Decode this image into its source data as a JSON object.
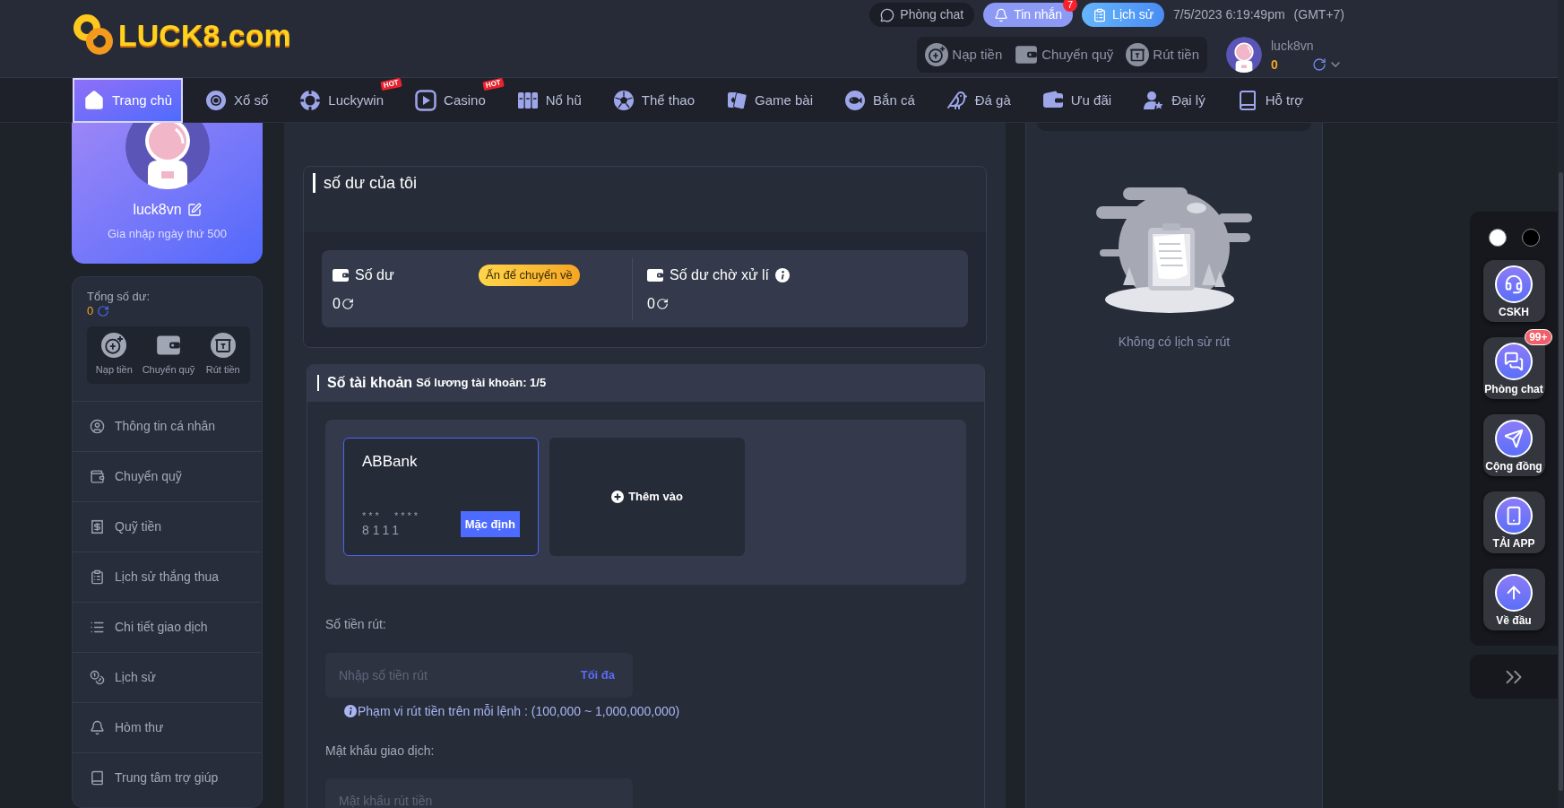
{
  "header": {
    "logo": "LUCK8.com",
    "top_buttons": [
      {
        "label": "Phòng chat"
      },
      {
        "label": "Tin nhắn",
        "badge": "7"
      },
      {
        "label": "Lịch sử"
      }
    ],
    "date": "7/5/2023 6:19:49pm",
    "timezone": "(GMT+7)",
    "wallet_actions": [
      "Nạp tiền",
      "Chuyển quỹ",
      "Rút tiền"
    ],
    "user": {
      "name": "luck8vn",
      "balance": "0"
    }
  },
  "nav": [
    {
      "label": "Trang chủ",
      "selected": true
    },
    {
      "label": "Xổ số",
      "selected": false
    },
    {
      "label": "Luckywin",
      "selected": false,
      "badge": "HOT"
    },
    {
      "label": "Casino",
      "selected": false,
      "badge": "HOT"
    },
    {
      "label": "Nổ hũ",
      "selected": false
    },
    {
      "label": "Thể thao",
      "selected": false
    },
    {
      "label": "Game bài",
      "selected": false
    },
    {
      "label": "Bắn cá",
      "selected": false
    },
    {
      "label": "Đá gà",
      "selected": false
    },
    {
      "label": "Ưu đãi",
      "selected": false
    },
    {
      "label": "Đại lý",
      "selected": false
    },
    {
      "label": "Hỗ trợ",
      "selected": false
    }
  ],
  "profile": {
    "name": "luck8vn",
    "joined": "Gia nhập ngày thứ 500"
  },
  "balance_card": {
    "label": "Tổng số dư:",
    "value": "0",
    "actions": [
      "Nạp tiền",
      "Chuyển quỹ",
      "Rút tiền"
    ]
  },
  "side_menu": [
    "Thông tin cá nhân",
    "Chuyển quỹ",
    "Quỹ tiền",
    "Lịch sử thắng thua",
    "Chi tiết giao dịch",
    "Lịch sử",
    "Hòm thư",
    "Trung tâm trợ giúp"
  ],
  "wallet": {
    "title": "số dư của tôi",
    "balances": [
      {
        "label": "Số dư",
        "value": "0",
        "action": "Ấn để chuyển về",
        "info": false
      },
      {
        "label": "Số dư chờ xử lí",
        "value": "0",
        "info": true
      }
    ]
  },
  "accounts": {
    "title": "Số tài khoản",
    "count": "Số lương tài khoản: 1/5",
    "cards": [
      {
        "kind": "bank",
        "selected": true,
        "bank": "ABBank",
        "masked": "*** ****",
        "last_digits": "8111",
        "default_label": "Mặc định"
      },
      {
        "kind": "add",
        "selected": false,
        "label": "Thêm vào"
      }
    ]
  },
  "withdraw": {
    "amount_label": "Số tiền rút:",
    "amount_placeholder": "Nhập số tiền rút",
    "max_label": "Tối đa",
    "range_note": "Phạm vi rút tiền trên mỗi lệnh : (100,000 ~ 1,000,000,000)",
    "password_label": "Mật khẩu giao dịch:",
    "password_placeholder": "Mật khẩu rút tiền"
  },
  "history": {
    "empty_text": "Không có lịch sử rút"
  },
  "float_menu": {
    "theme_dots": [
      {
        "color": "#ffffff"
      },
      {
        "color": "#000000"
      }
    ],
    "items": [
      {
        "label": "CSKH"
      },
      {
        "label": "Phòng chat",
        "badge": "99+"
      },
      {
        "label": "Cộng đồng"
      },
      {
        "label": "TẢI APP"
      },
      {
        "label": "Về đầu"
      }
    ]
  }
}
